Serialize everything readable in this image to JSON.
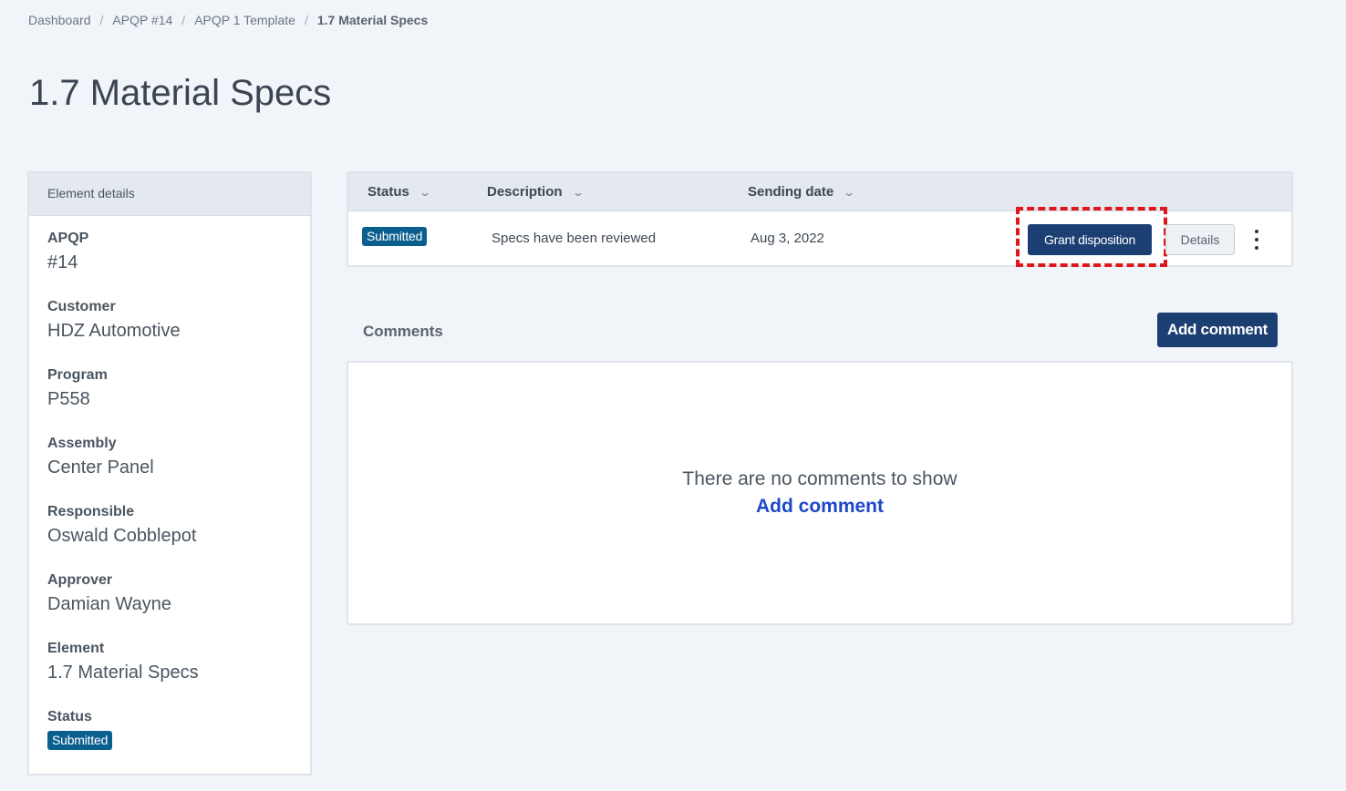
{
  "breadcrumb": {
    "items": [
      "Dashboard",
      "APQP #14",
      "APQP 1 Template"
    ],
    "current": "1.7 Material Specs",
    "separator": "/"
  },
  "page_title": "1.7 Material Specs",
  "details": {
    "header": "Element details",
    "fields": [
      {
        "label": "APQP",
        "value": "#14"
      },
      {
        "label": "Customer",
        "value": "HDZ Automotive"
      },
      {
        "label": "Program",
        "value": "P558"
      },
      {
        "label": "Assembly",
        "value": "Center Panel"
      },
      {
        "label": "Responsible",
        "value": "Oswald Cobblepot"
      },
      {
        "label": "Approver",
        "value": "Damian Wayne"
      },
      {
        "label": "Element",
        "value": "1.7 Material Specs"
      }
    ],
    "status_label": "Status",
    "status_value": "Submitted"
  },
  "table": {
    "columns": [
      "Status",
      "Description",
      "Sending date"
    ],
    "row": {
      "status": "Submitted",
      "description": "Specs have been reviewed",
      "sending_date": "Aug 3, 2022"
    },
    "grant_label": "Grant disposition",
    "details_label": "Details"
  },
  "comments": {
    "label": "Comments",
    "add_button": "Add comment",
    "empty_text": "There are no comments to show",
    "empty_link": "Add comment"
  },
  "colors": {
    "primary": "#1c3f73",
    "badge": "#0b5f8f",
    "highlight": "#e0161b",
    "link": "#1d47c8"
  }
}
